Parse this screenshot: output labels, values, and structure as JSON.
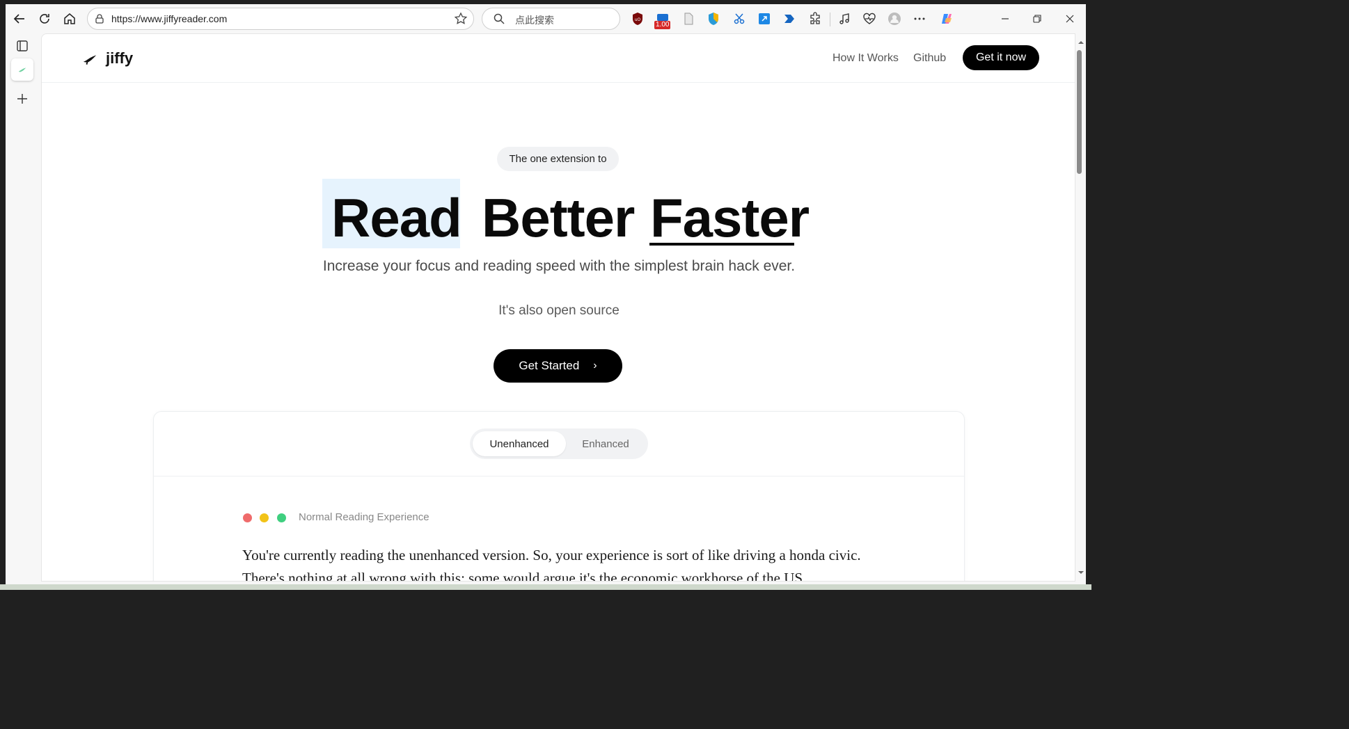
{
  "browser": {
    "url": "https://www.jiffyreader.com",
    "search_placeholder": "点此搜索",
    "ext_badge": "1.00"
  },
  "site": {
    "logo_text": "jiffy",
    "nav": {
      "how_it_works": "How It Works",
      "github": "Github",
      "cta": "Get it now"
    },
    "pill": "The one extension to",
    "headline": {
      "word1": "Read",
      "word2": "Better",
      "word3": "Faster"
    },
    "subtitle": "Increase your focus and reading speed with the simplest brain hack ever.",
    "subtitle2": "It's also open source",
    "get_started": "Get Started",
    "demo": {
      "tab_active": "Unenhanced",
      "tab_inactive": "Enhanced",
      "label": "Normal Reading Experience",
      "text": "You're currently reading the unenhanced version. So, your experience is sort of like driving a honda civic. There's nothing at all wrong with this; some would argue it's the economic workhorse of the US.",
      "dot_colors": [
        "#ef6b6b",
        "#f2c318",
        "#3fcf7f"
      ]
    }
  }
}
